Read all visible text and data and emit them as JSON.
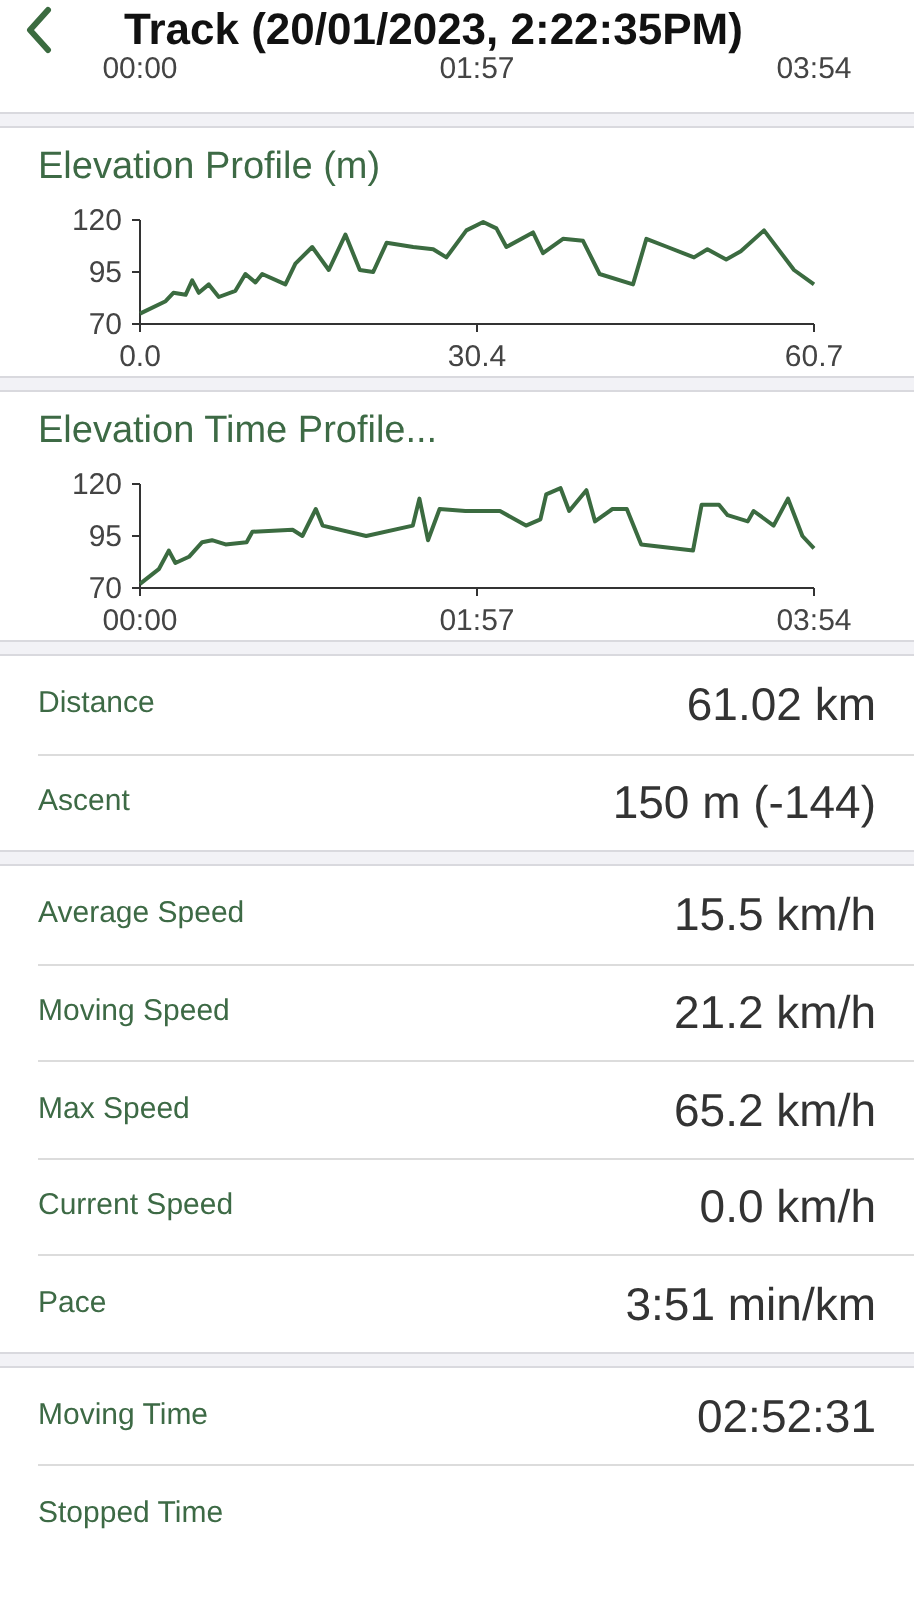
{
  "header": {
    "title": "Track (20/01/2023, 2:22:35PM)"
  },
  "top_chart_axis": {
    "labels": [
      "00:00",
      "01:57",
      "03:54"
    ]
  },
  "charts": [
    {
      "title": "Elevation Profile (m)",
      "chart_data": {
        "type": "line",
        "x": [
          0,
          2.3,
          3.0,
          4.1,
          4.7,
          5.3,
          6.2,
          7.1,
          8.6,
          9.5,
          10.4,
          11.0,
          13.1,
          14.0,
          15.5,
          17.0,
          18.5,
          19.8,
          21.0,
          22.2,
          24.6,
          26.4,
          27.6,
          29.4,
          30.9,
          32.1,
          33.0,
          35.4,
          36.3,
          38.1,
          39.9,
          41.4,
          44.4,
          45.6,
          47.5,
          49.9,
          51.1,
          52.8,
          54.1,
          56.2,
          58.9,
          60.7
        ],
        "series": [
          {
            "color": "#3b6b40",
            "values": [
              75,
              81,
              85,
              84,
              91,
              85,
              89,
              83,
              86,
              94,
              90,
              94,
              89,
              99,
              107,
              96,
              113,
              96,
              95,
              109,
              107,
              106,
              102,
              115,
              119,
              116,
              107,
              114,
              104,
              111,
              110,
              94,
              89,
              111,
              107,
              102,
              106,
              101,
              105,
              115,
              96,
              89
            ]
          }
        ],
        "xlim": [
          0,
          60.7
        ],
        "ylim": [
          70,
          120
        ],
        "xticks": [
          {
            "value": 0,
            "label": "0.0"
          },
          {
            "value": 30.35,
            "label": "30.4"
          },
          {
            "value": 60.7,
            "label": "60.7"
          }
        ],
        "yticks": [
          70,
          95,
          120
        ]
      }
    },
    {
      "title": "Elevation Time Profile...",
      "chart_data": {
        "type": "line",
        "x": [
          0,
          6.5,
          10,
          12.3,
          17,
          21.6,
          25,
          29.7,
          37,
          39,
          53,
          56.4,
          61,
          63.4,
          78.5,
          94.7,
          97,
          100,
          104,
          113,
          125,
          134,
          139,
          141,
          146,
          149,
          155,
          158,
          164,
          169,
          174,
          192,
          195,
          201,
          204,
          211,
          213,
          220,
          225,
          230,
          234
        ],
        "series": [
          {
            "color": "#3b6b40",
            "values": [
              72,
              79,
              88,
              82,
              85,
              92,
              93,
              91,
              92,
              97,
              98,
              95,
              108,
              100,
              95,
              100,
              113,
              93,
              108,
              107,
              107,
              100,
              103,
              115,
              118,
              107,
              117,
              102,
              108,
              108,
              91,
              88,
              110,
              110,
              105,
              102,
              107,
              100,
              113,
              95,
              89
            ]
          }
        ],
        "xlim": [
          0,
          234
        ],
        "ylim": [
          70,
          120
        ],
        "xticks": [
          {
            "value": 0,
            "label": "00:00"
          },
          {
            "value": 117,
            "label": "01:57"
          },
          {
            "value": 234,
            "label": "03:54"
          }
        ],
        "yticks": [
          70,
          95,
          120
        ]
      }
    }
  ],
  "stat_groups": [
    [
      {
        "label": "Distance",
        "value": "61.02 km"
      },
      {
        "label": "Ascent",
        "value": "150 m (-144)"
      }
    ],
    [
      {
        "label": "Average Speed",
        "value": "15.5 km/h"
      },
      {
        "label": "Moving Speed",
        "value": "21.2 km/h"
      },
      {
        "label": "Max Speed",
        "value": "65.2 km/h"
      },
      {
        "label": "Current Speed",
        "value": "0.0 km/h"
      },
      {
        "label": "Pace",
        "value": "3:51 min/km"
      }
    ],
    [
      {
        "label": "Moving Time",
        "value": "02:52:31"
      },
      {
        "label": "Stopped Time"
      }
    ]
  ]
}
